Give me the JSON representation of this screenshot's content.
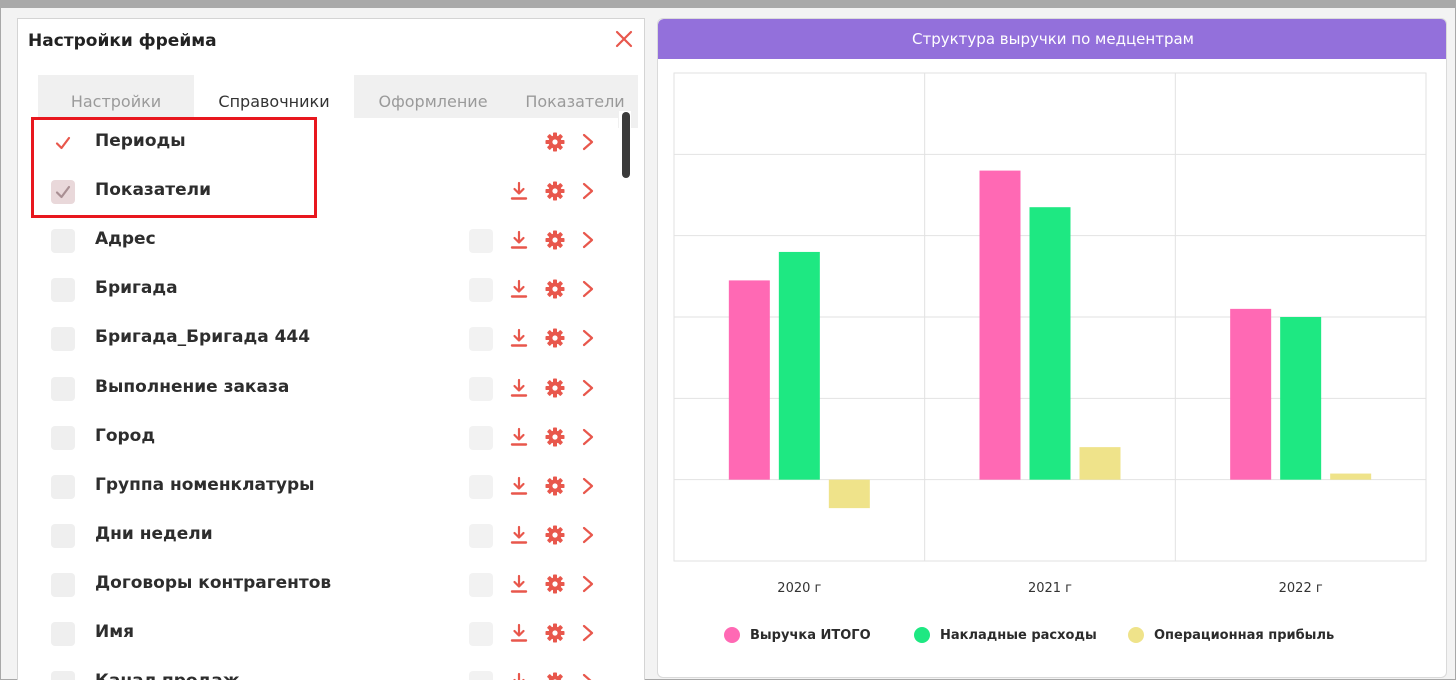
{
  "panel": {
    "title": "Настройки фрейма",
    "tabs": [
      {
        "label": "Настройки",
        "active": false
      },
      {
        "label": "Справочники",
        "active": true
      },
      {
        "label": "Оформление",
        "active": false
      },
      {
        "label": "Показатели",
        "active": false
      }
    ],
    "items": [
      {
        "label": "Периоды",
        "checked": true,
        "dim": false,
        "toggle": false,
        "download": false
      },
      {
        "label": "Показатели",
        "checked": true,
        "dim": true,
        "toggle": false,
        "download": true
      },
      {
        "label": "Адрес",
        "checked": false,
        "dim": false,
        "toggle": true,
        "download": true
      },
      {
        "label": "Бригада",
        "checked": false,
        "dim": false,
        "toggle": true,
        "download": true
      },
      {
        "label": "Бригада_Бригада 444",
        "checked": false,
        "dim": false,
        "toggle": true,
        "download": true
      },
      {
        "label": "Выполнение заказа",
        "checked": false,
        "dim": false,
        "toggle": true,
        "download": true
      },
      {
        "label": "Город",
        "checked": false,
        "dim": false,
        "toggle": true,
        "download": true
      },
      {
        "label": "Группа номенклатуры",
        "checked": false,
        "dim": false,
        "toggle": true,
        "download": true
      },
      {
        "label": "Дни недели",
        "checked": false,
        "dim": false,
        "toggle": true,
        "download": true
      },
      {
        "label": "Договоры контрагентов",
        "checked": false,
        "dim": false,
        "toggle": true,
        "download": true
      },
      {
        "label": "Имя",
        "checked": false,
        "dim": false,
        "toggle": true,
        "download": true
      },
      {
        "label": "Канал продаж",
        "checked": false,
        "dim": false,
        "toggle": true,
        "download": true
      }
    ]
  },
  "colors": {
    "accent": "#e8574c",
    "header": "#9370db",
    "highlight": "#e8171e"
  },
  "chart_data": {
    "type": "bar",
    "title": "Структура выручки по медцентрам",
    "categories": [
      "2020 г",
      "2021 г",
      "2022 г"
    ],
    "series": [
      {
        "name": "Выручка ИТОГО",
        "color": "#ff69b4",
        "values": [
          49,
          76,
          42
        ]
      },
      {
        "name": "Накладные расходы",
        "color": "#1ee882",
        "values": [
          56,
          67,
          40
        ]
      },
      {
        "name": "Операционная прибыль",
        "color": "#efe38a",
        "values": [
          -7,
          8,
          1.5
        ]
      }
    ],
    "ylim": [
      -20,
      100
    ],
    "grid": true,
    "legend": "bottom"
  }
}
